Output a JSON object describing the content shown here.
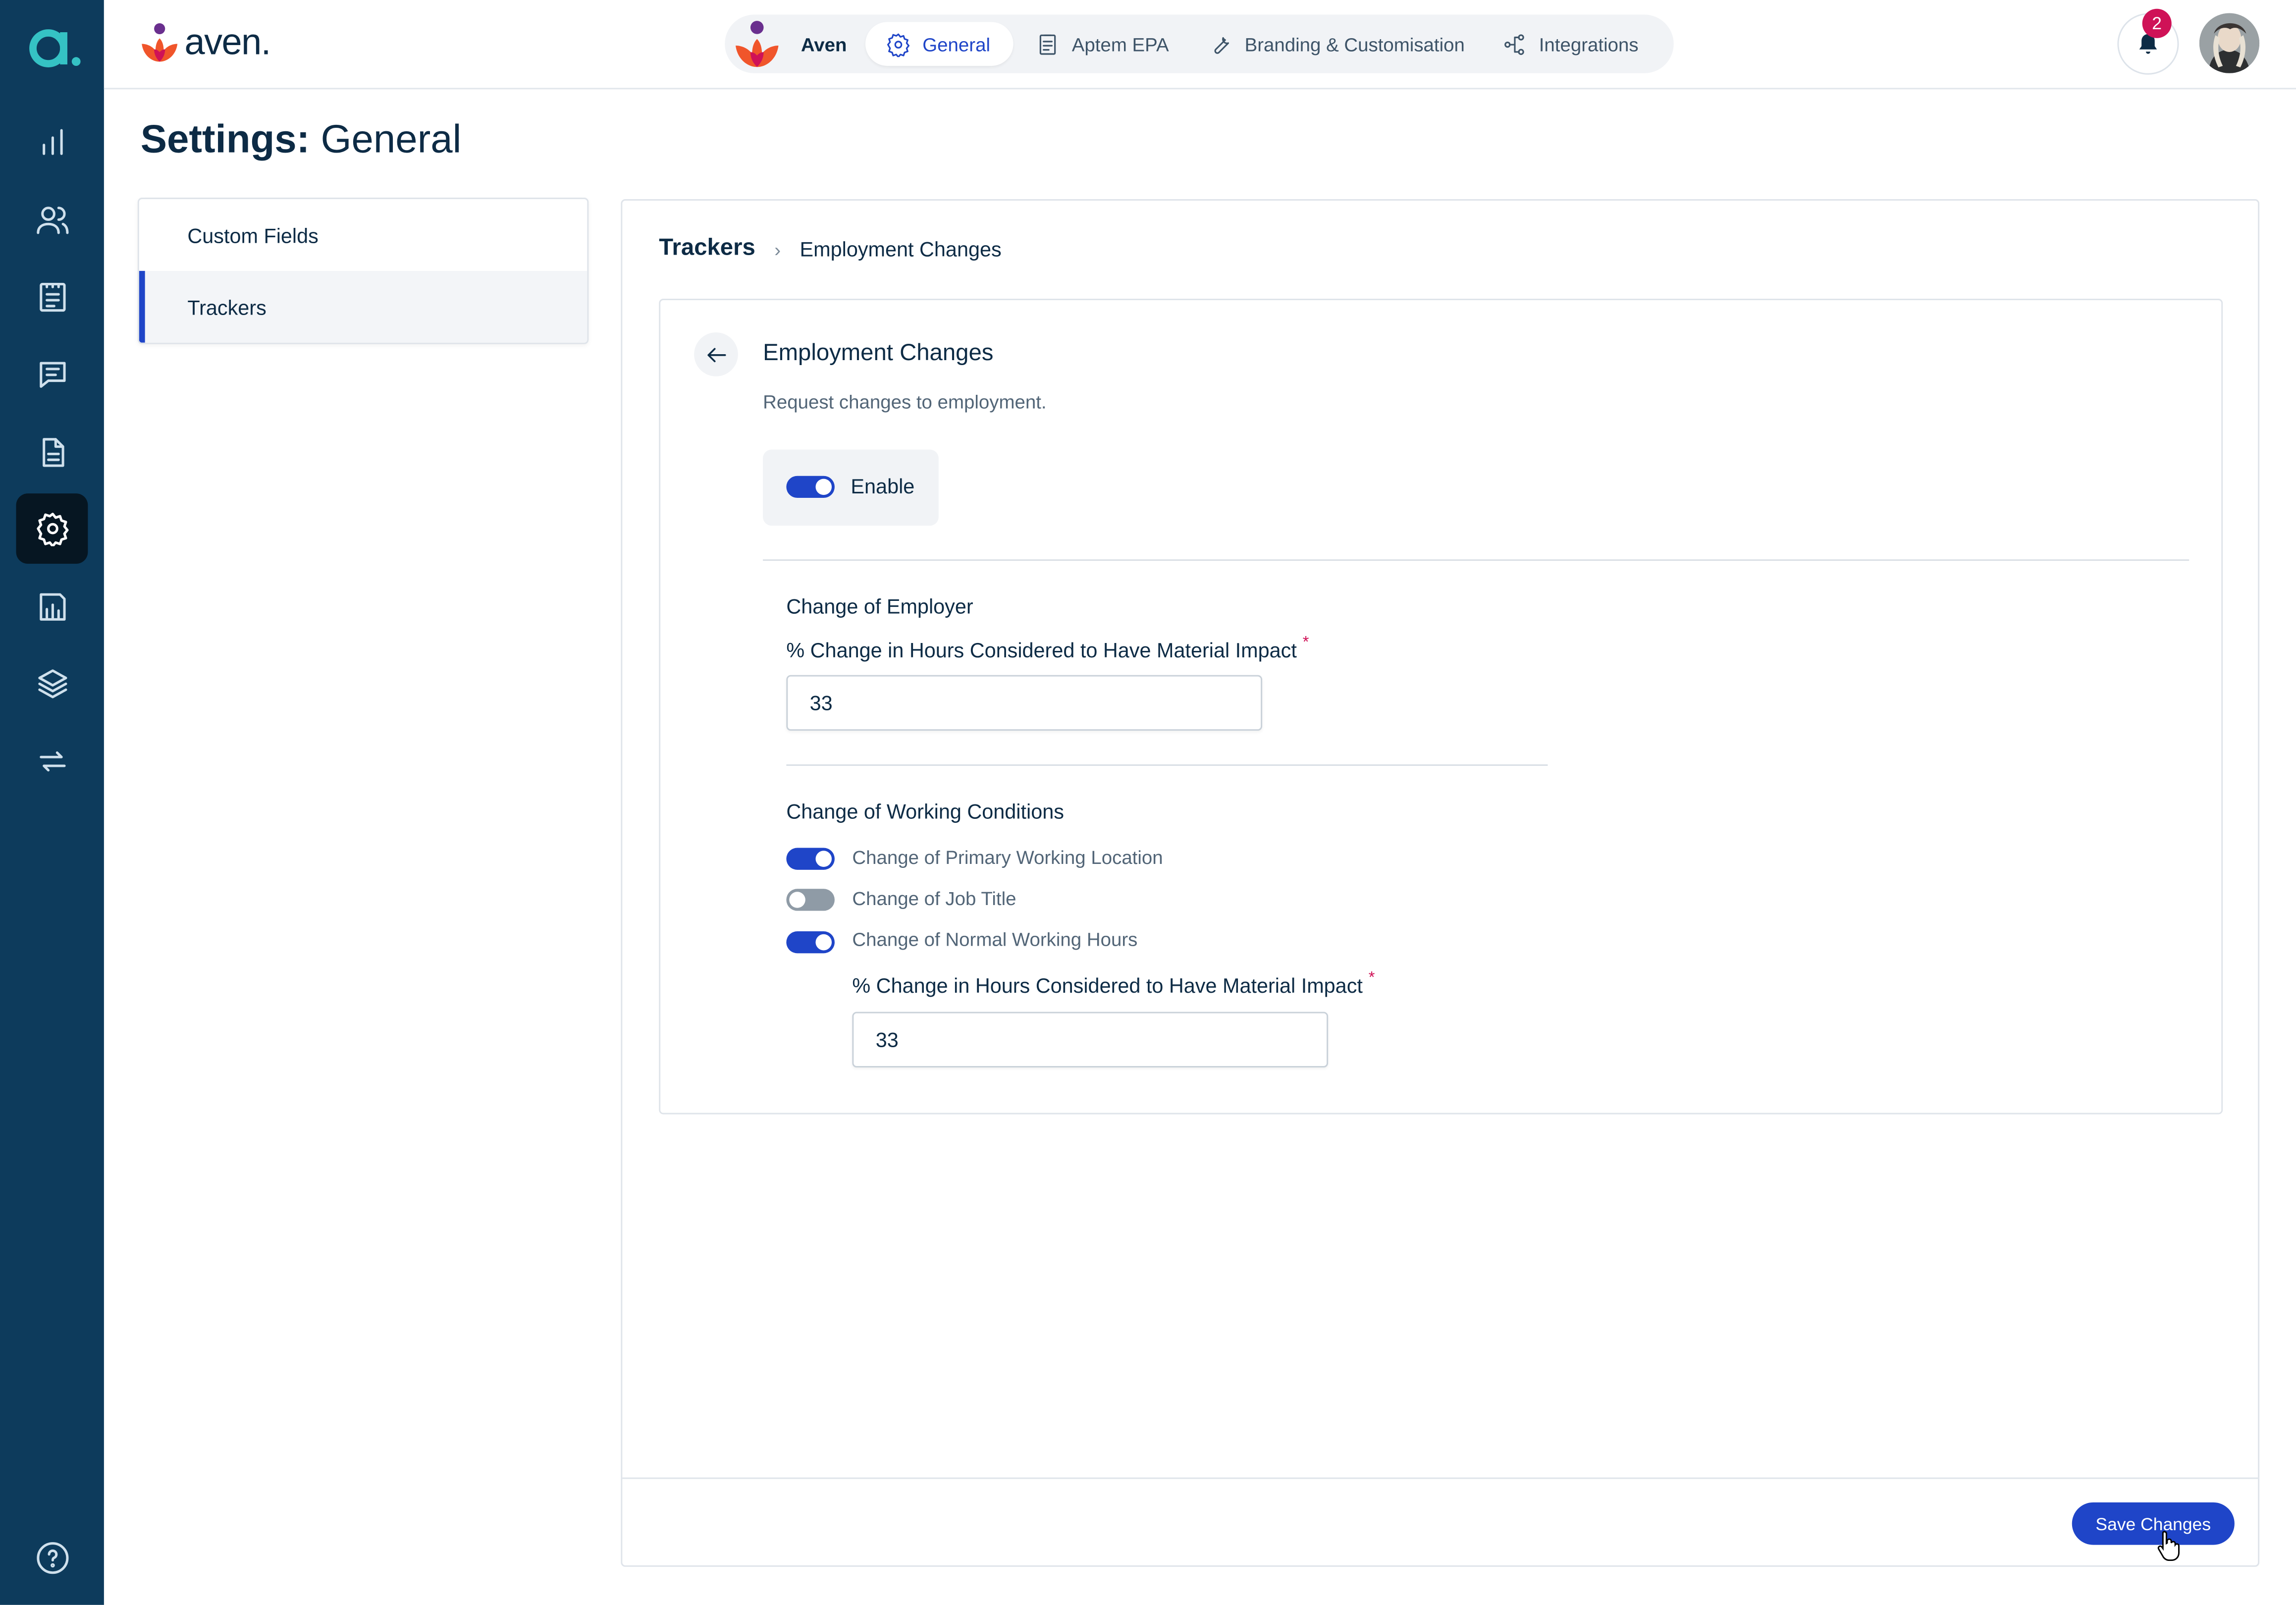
{
  "colors": {
    "rail_bg": "#0d3b5c",
    "accent": "#1f45c8",
    "badge": "#cf1257",
    "text": "#0d2b45"
  },
  "rail": {
    "logo_text": "a.",
    "items": [
      {
        "icon": "bar-chart-icon"
      },
      {
        "icon": "users-icon"
      },
      {
        "icon": "clipboard-icon"
      },
      {
        "icon": "message-icon"
      },
      {
        "icon": "document-icon"
      },
      {
        "icon": "gear-icon",
        "active": true
      },
      {
        "icon": "report-icon"
      },
      {
        "icon": "layers-icon"
      },
      {
        "icon": "sync-icon"
      }
    ],
    "help_icon": "help-icon"
  },
  "topbar": {
    "brand": "aven.",
    "org_name": "Aven",
    "tabs": [
      {
        "label": "General",
        "icon": "gear-icon",
        "active": true
      },
      {
        "label": "Aptem EPA",
        "icon": "clipboard-icon"
      },
      {
        "label": "Branding & Customisation",
        "icon": "wrench-icon"
      },
      {
        "label": "Integrations",
        "icon": "integrations-icon"
      }
    ],
    "notification_count": "2"
  },
  "page": {
    "title_bold": "Settings:",
    "title_rest": "General"
  },
  "subnav": {
    "items": [
      {
        "label": "Custom Fields"
      },
      {
        "label": "Trackers",
        "active": true
      }
    ]
  },
  "breadcrumb": {
    "root": "Trackers",
    "current": "Employment Changes"
  },
  "tracker": {
    "title": "Employment Changes",
    "description": "Request changes to employment.",
    "enable_label": "Enable",
    "enabled": true,
    "employer_section": {
      "title": "Change of Employer",
      "field_label": "% Change in Hours Considered to Have Material Impact",
      "required_mark": "*",
      "value": "33"
    },
    "conditions_section": {
      "title": "Change of Working Conditions",
      "options": [
        {
          "label": "Change of Primary Working Location",
          "on": true
        },
        {
          "label": "Change of Job Title",
          "on": false
        },
        {
          "label": "Change of Normal Working Hours",
          "on": true
        }
      ],
      "field_label": "% Change in Hours Considered to Have Material Impact",
      "required_mark": "*",
      "value": "33"
    }
  },
  "footer": {
    "save_label": "Save Changes"
  }
}
